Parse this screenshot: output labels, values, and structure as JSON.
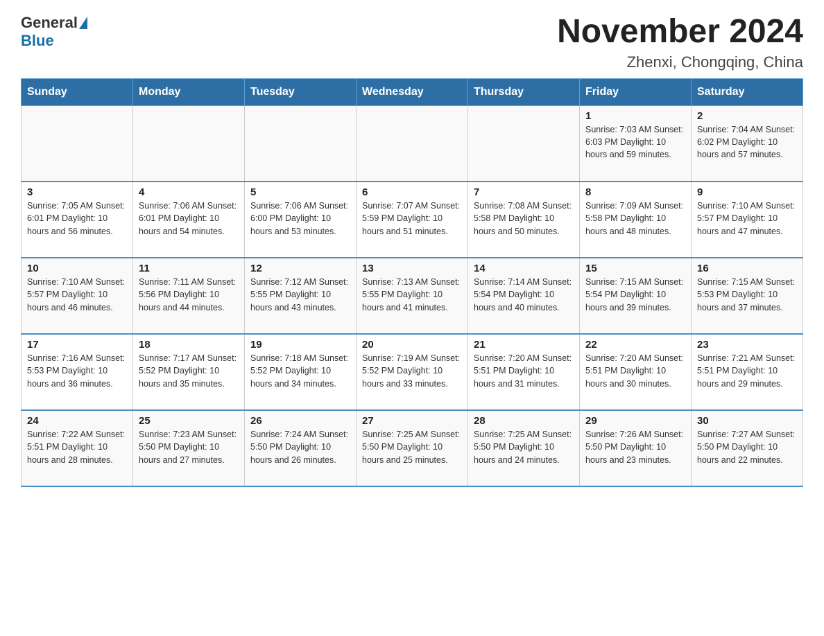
{
  "header": {
    "logo_general": "General",
    "logo_blue": "Blue",
    "month_title": "November 2024",
    "location": "Zhenxi, Chongqing, China"
  },
  "days_of_week": [
    "Sunday",
    "Monday",
    "Tuesday",
    "Wednesday",
    "Thursday",
    "Friday",
    "Saturday"
  ],
  "weeks": [
    [
      {
        "day": "",
        "info": ""
      },
      {
        "day": "",
        "info": ""
      },
      {
        "day": "",
        "info": ""
      },
      {
        "day": "",
        "info": ""
      },
      {
        "day": "",
        "info": ""
      },
      {
        "day": "1",
        "info": "Sunrise: 7:03 AM\nSunset: 6:03 PM\nDaylight: 10 hours\nand 59 minutes."
      },
      {
        "day": "2",
        "info": "Sunrise: 7:04 AM\nSunset: 6:02 PM\nDaylight: 10 hours\nand 57 minutes."
      }
    ],
    [
      {
        "day": "3",
        "info": "Sunrise: 7:05 AM\nSunset: 6:01 PM\nDaylight: 10 hours\nand 56 minutes."
      },
      {
        "day": "4",
        "info": "Sunrise: 7:06 AM\nSunset: 6:01 PM\nDaylight: 10 hours\nand 54 minutes."
      },
      {
        "day": "5",
        "info": "Sunrise: 7:06 AM\nSunset: 6:00 PM\nDaylight: 10 hours\nand 53 minutes."
      },
      {
        "day": "6",
        "info": "Sunrise: 7:07 AM\nSunset: 5:59 PM\nDaylight: 10 hours\nand 51 minutes."
      },
      {
        "day": "7",
        "info": "Sunrise: 7:08 AM\nSunset: 5:58 PM\nDaylight: 10 hours\nand 50 minutes."
      },
      {
        "day": "8",
        "info": "Sunrise: 7:09 AM\nSunset: 5:58 PM\nDaylight: 10 hours\nand 48 minutes."
      },
      {
        "day": "9",
        "info": "Sunrise: 7:10 AM\nSunset: 5:57 PM\nDaylight: 10 hours\nand 47 minutes."
      }
    ],
    [
      {
        "day": "10",
        "info": "Sunrise: 7:10 AM\nSunset: 5:57 PM\nDaylight: 10 hours\nand 46 minutes."
      },
      {
        "day": "11",
        "info": "Sunrise: 7:11 AM\nSunset: 5:56 PM\nDaylight: 10 hours\nand 44 minutes."
      },
      {
        "day": "12",
        "info": "Sunrise: 7:12 AM\nSunset: 5:55 PM\nDaylight: 10 hours\nand 43 minutes."
      },
      {
        "day": "13",
        "info": "Sunrise: 7:13 AM\nSunset: 5:55 PM\nDaylight: 10 hours\nand 41 minutes."
      },
      {
        "day": "14",
        "info": "Sunrise: 7:14 AM\nSunset: 5:54 PM\nDaylight: 10 hours\nand 40 minutes."
      },
      {
        "day": "15",
        "info": "Sunrise: 7:15 AM\nSunset: 5:54 PM\nDaylight: 10 hours\nand 39 minutes."
      },
      {
        "day": "16",
        "info": "Sunrise: 7:15 AM\nSunset: 5:53 PM\nDaylight: 10 hours\nand 37 minutes."
      }
    ],
    [
      {
        "day": "17",
        "info": "Sunrise: 7:16 AM\nSunset: 5:53 PM\nDaylight: 10 hours\nand 36 minutes."
      },
      {
        "day": "18",
        "info": "Sunrise: 7:17 AM\nSunset: 5:52 PM\nDaylight: 10 hours\nand 35 minutes."
      },
      {
        "day": "19",
        "info": "Sunrise: 7:18 AM\nSunset: 5:52 PM\nDaylight: 10 hours\nand 34 minutes."
      },
      {
        "day": "20",
        "info": "Sunrise: 7:19 AM\nSunset: 5:52 PM\nDaylight: 10 hours\nand 33 minutes."
      },
      {
        "day": "21",
        "info": "Sunrise: 7:20 AM\nSunset: 5:51 PM\nDaylight: 10 hours\nand 31 minutes."
      },
      {
        "day": "22",
        "info": "Sunrise: 7:20 AM\nSunset: 5:51 PM\nDaylight: 10 hours\nand 30 minutes."
      },
      {
        "day": "23",
        "info": "Sunrise: 7:21 AM\nSunset: 5:51 PM\nDaylight: 10 hours\nand 29 minutes."
      }
    ],
    [
      {
        "day": "24",
        "info": "Sunrise: 7:22 AM\nSunset: 5:51 PM\nDaylight: 10 hours\nand 28 minutes."
      },
      {
        "day": "25",
        "info": "Sunrise: 7:23 AM\nSunset: 5:50 PM\nDaylight: 10 hours\nand 27 minutes."
      },
      {
        "day": "26",
        "info": "Sunrise: 7:24 AM\nSunset: 5:50 PM\nDaylight: 10 hours\nand 26 minutes."
      },
      {
        "day": "27",
        "info": "Sunrise: 7:25 AM\nSunset: 5:50 PM\nDaylight: 10 hours\nand 25 minutes."
      },
      {
        "day": "28",
        "info": "Sunrise: 7:25 AM\nSunset: 5:50 PM\nDaylight: 10 hours\nand 24 minutes."
      },
      {
        "day": "29",
        "info": "Sunrise: 7:26 AM\nSunset: 5:50 PM\nDaylight: 10 hours\nand 23 minutes."
      },
      {
        "day": "30",
        "info": "Sunrise: 7:27 AM\nSunset: 5:50 PM\nDaylight: 10 hours\nand 22 minutes."
      }
    ]
  ]
}
